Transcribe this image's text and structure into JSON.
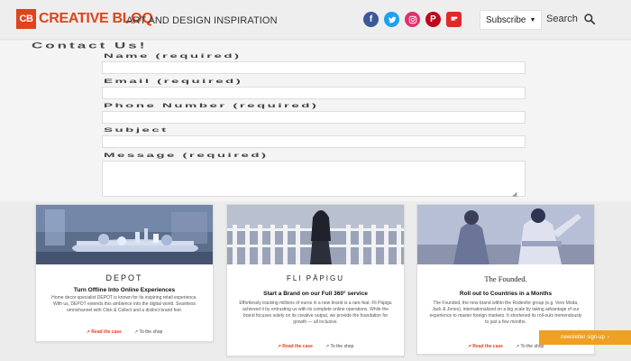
{
  "header": {
    "logo_badge": "CB",
    "logo_text": "CREATIVE BLOQ",
    "tagline": "ART AND DESIGN INSPIRATION",
    "socials": [
      {
        "name": "facebook",
        "glyph": "f",
        "color": "#3b5998"
      },
      {
        "name": "twitter",
        "glyph": "t",
        "color": "#1da1f2"
      },
      {
        "name": "instagram",
        "glyph": "◎",
        "color": "#e1306c"
      },
      {
        "name": "pinterest",
        "glyph": "P",
        "color": "#bd081c"
      },
      {
        "name": "flipboard",
        "glyph": "f",
        "color": "#e12828"
      }
    ],
    "subscribe_label": "Subscribe",
    "search_label": "Search"
  },
  "form": {
    "title": "Contact Us!",
    "fields": [
      {
        "label": "Name (required)"
      },
      {
        "label": "Email (required)"
      },
      {
        "label": "Phone Number (required)"
      },
      {
        "label": "Subject"
      },
      {
        "label": "Message (required)"
      }
    ]
  },
  "cards": [
    {
      "brand": "DEPOT",
      "subtitle": "Turn Offline Into Online Experiences",
      "body": "Home decor specialist DEPOT is known for its inspiring retail experience. With us, DEPOT extends this ambience into the digital world. Seamless omnichannel with Click & Collect and a distinct brand feel.",
      "read_label": "Read the case",
      "shop_label": "To the shop"
    },
    {
      "brand": "FLI PĀPIGU",
      "subtitle": "Start a Brand on our Full 360° service",
      "body": "Effortlessly tracking millions of euros in a new brand is a rare feat. Fli Pāpigu achieved it by entrusting us with its complete online operations. While the brand focuses solely on its creative output, we provide the foundation for growth — all inclusive.",
      "read_label": "Read the case",
      "shop_label": "To the shop"
    },
    {
      "brand": "The Founded.",
      "subtitle": "Roll out to Countries in a Months",
      "body": "The Founded, the new brand within the Rodeofor group (e.g. Vero Moda, Jack & Jones), internationalized on a big scale by taking advantage of our experience to master foreign markets. It shortened its roll-outs tremendously to just a few months.",
      "read_label": "Read the case",
      "shop_label": "To the shop"
    }
  ],
  "newsletter_label": "newsletter sign-up"
}
